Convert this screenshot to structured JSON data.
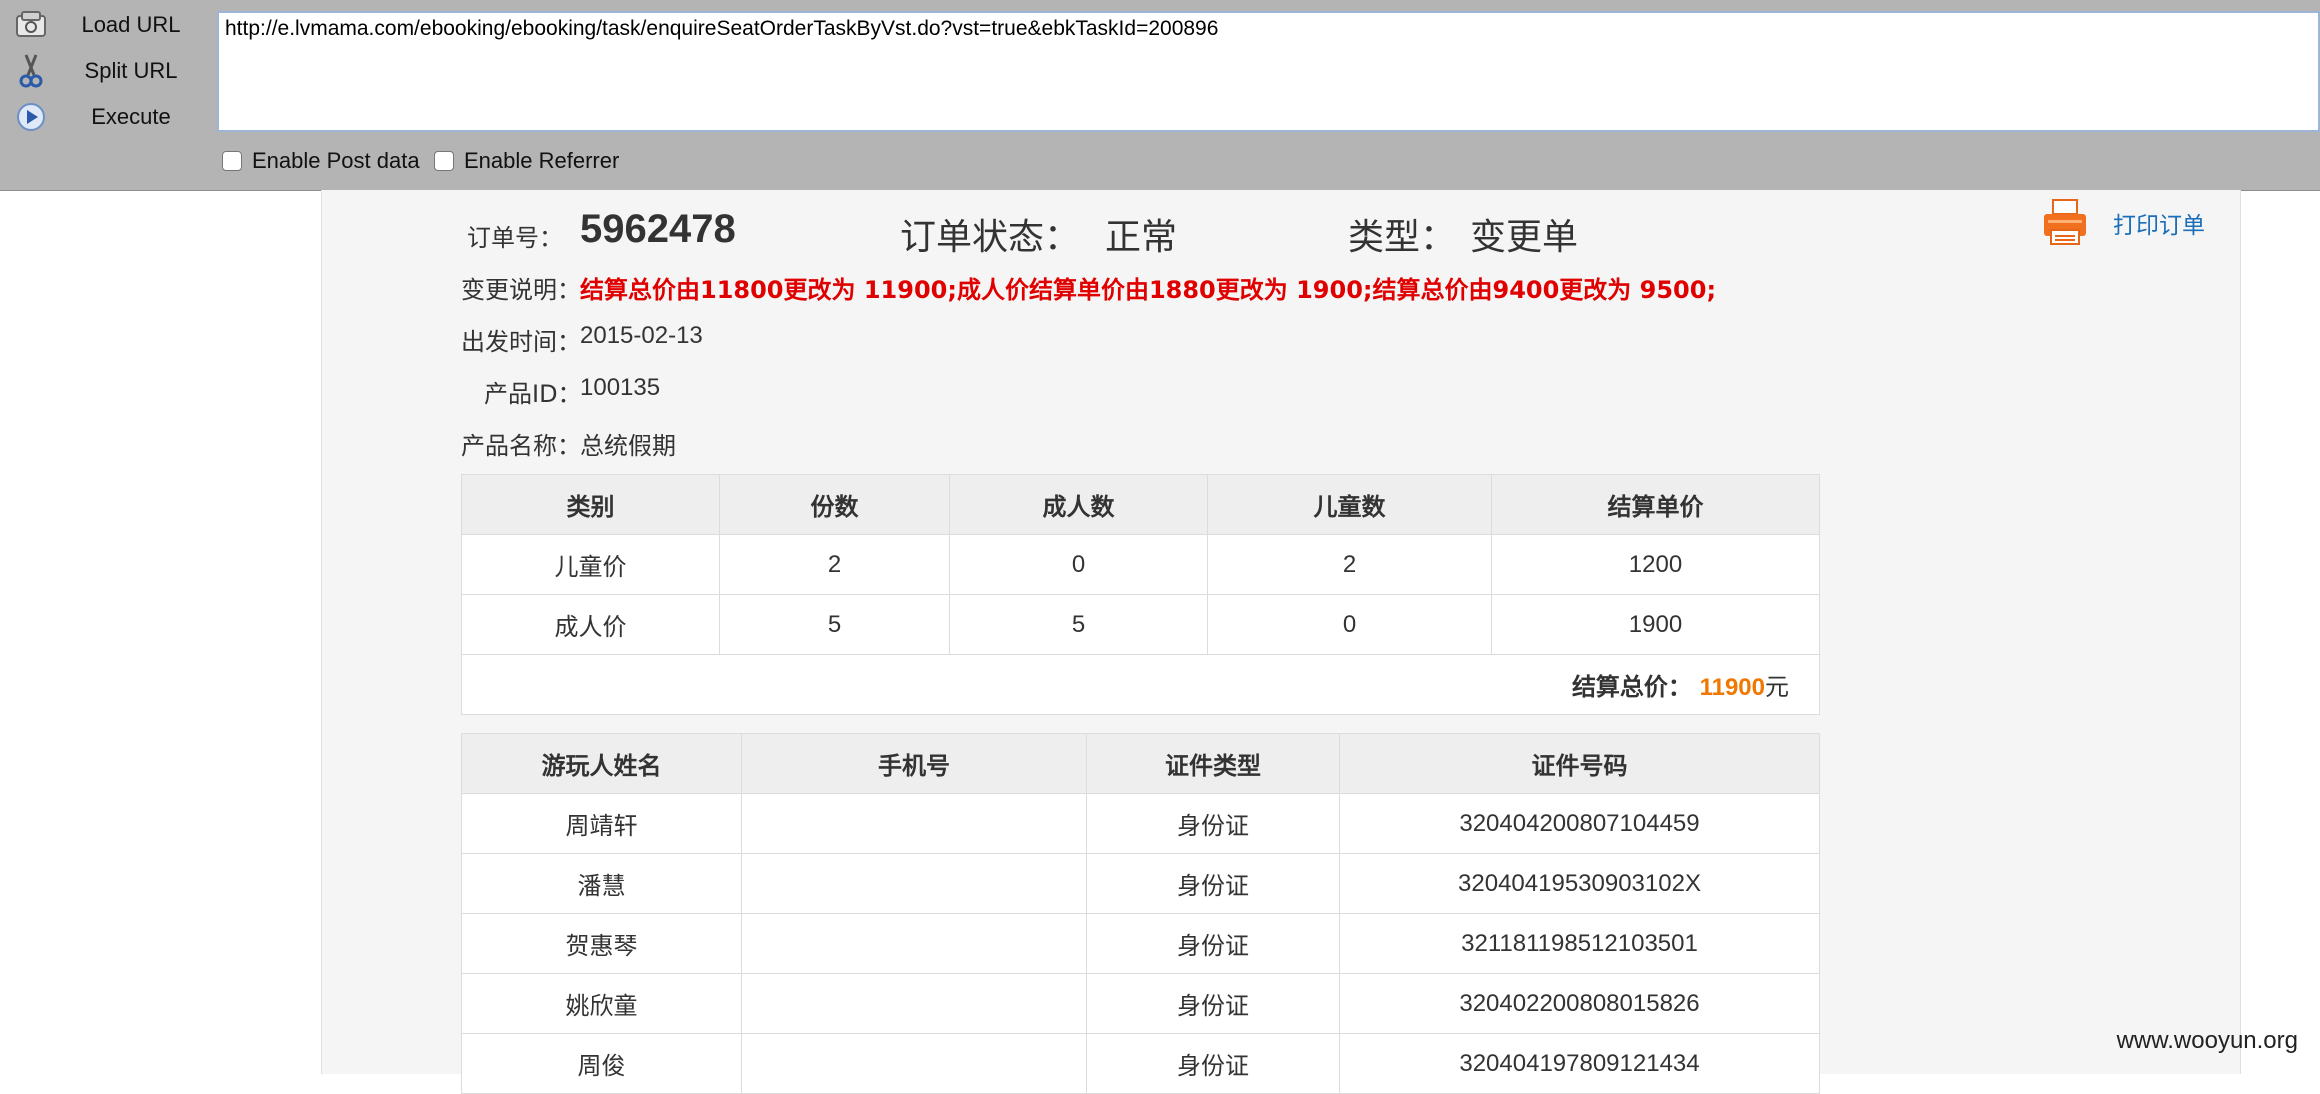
{
  "hackbar": {
    "buttons": [
      {
        "label": "Load URL",
        "icon": "load-url-icon"
      },
      {
        "label": "Split URL",
        "icon": "scissors-icon"
      },
      {
        "label": "Execute",
        "icon": "execute-icon"
      }
    ],
    "url": "http://e.lvmama.com/ebooking/ebooking/task/enquireSeatOrderTaskByVst.do?vst=true&ebkTaskId=200896",
    "enable_post_label": "Enable Post data",
    "enable_referrer_label": "Enable Referrer"
  },
  "order": {
    "order_no_label": "订单号：",
    "order_no": "5962478",
    "status_label": "订单状态：",
    "status_value": "正常",
    "type_label": "类型：",
    "type_value": "变更单",
    "print_label": "打印订单",
    "change_label": "变更说明：",
    "change_text": "结算总价由11800更改为 11900;成人价结算单价由1880更改为 1900;结算总价由9400更改为 9500;",
    "depart_label": "出发时间：",
    "depart_value": "2015-02-13",
    "product_id_label": "产品ID：",
    "product_id_value": "100135",
    "product_name_label": "产品名称：",
    "product_name_value": "总统假期"
  },
  "price_table": {
    "headers": [
      "类别",
      "份数",
      "成人数",
      "儿童数",
      "结算单价"
    ],
    "rows": [
      [
        "儿童价",
        "2",
        "0",
        "2",
        "1200"
      ],
      [
        "成人价",
        "5",
        "5",
        "0",
        "1900"
      ]
    ],
    "total_label": "结算总价：",
    "total_value": "11900",
    "total_unit": "元"
  },
  "traveler_table": {
    "headers": [
      "游玩人姓名",
      "手机号",
      "证件类型",
      "证件号码"
    ],
    "rows": [
      [
        "周靖轩",
        "",
        "身份证",
        "320404200807104459"
      ],
      [
        "潘慧",
        "",
        "身份证",
        "32040419530903102X"
      ],
      [
        "贺惠琴",
        "",
        "身份证",
        "321181198512103501"
      ],
      [
        "姚欣童",
        "",
        "身份证",
        "320402200808015826"
      ],
      [
        "周俊",
        "",
        "身份证",
        "320404197809121434"
      ]
    ]
  },
  "watermark": "www.wooyun.org",
  "colors": {
    "toolbar_bg": "#b4b4b4",
    "change_text": "#e00000",
    "total_value": "#f07800",
    "link": "#1a6fb8"
  }
}
